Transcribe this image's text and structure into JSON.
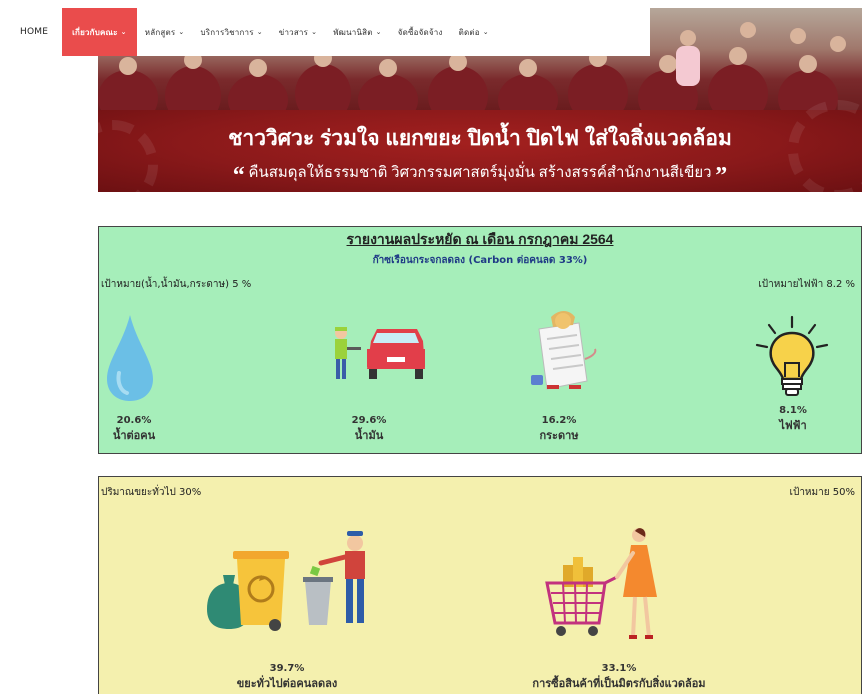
{
  "nav": {
    "items": [
      {
        "label": "HOME",
        "active": false,
        "has_chevron": false
      },
      {
        "label": "เกี่ยวกับคณะ",
        "active": true,
        "has_chevron": true
      },
      {
        "label": "หลักสูตร",
        "active": false,
        "has_chevron": true
      },
      {
        "label": "บริการวิชาการ",
        "active": false,
        "has_chevron": true
      },
      {
        "label": "ข่าวสาร",
        "active": false,
        "has_chevron": true
      },
      {
        "label": "พัฒนานิสิต",
        "active": false,
        "has_chevron": true
      },
      {
        "label": "จัดซื้อจัดจ้าง",
        "active": false,
        "has_chevron": false
      },
      {
        "label": "ติดต่อ",
        "active": false,
        "has_chevron": true
      }
    ],
    "active_color": "#ea4c4c"
  },
  "banner": {
    "title": "ชาววิศวะ ร่วมใจ แยกขยะ ปิดน้ำ ปิดไฟ ใส่ใจสิ่งแวดล้อม",
    "subtitle": "คืนสมดุลให้ธรรมชาติ วิศวกรรมศาสตร์มุ่งมั่น สร้างสรรค์สำนักงานสีเขียว",
    "open_quote": "“",
    "close_quote": "”",
    "band_color": "#8a191a"
  },
  "energy_report": {
    "title": "รายงานผลประหยัด ณ เดือน กรกฎาคม 2564",
    "subtitle": "ก๊าซเรือนกระจกลดลง (Carbon ต่อคนลด 33%)",
    "target_left": "เป้าหมาย(น้ำ,น้ำมัน,กระดาษ) 5 %",
    "target_right": "เป้าหมายไฟฟ้า 8.2 %",
    "background": "#a6eeba",
    "stats": [
      {
        "value": "20.6%",
        "label": "น้ำต่อคน",
        "icon": "water-drop-icon"
      },
      {
        "value": "29.6%",
        "label": "น้ำมัน",
        "icon": "car-fuel-icon"
      },
      {
        "value": "16.2%",
        "label": "กระดาษ",
        "icon": "paper-icon"
      },
      {
        "value": "8.1%",
        "label": "ไฟฟ้า",
        "icon": "lightbulb-icon"
      }
    ]
  },
  "waste_report": {
    "label_left": "ปริมาณขยะทั่วไป 30%",
    "label_right": "เป้าหมาย 50%",
    "background": "#f4f0ae",
    "stats": [
      {
        "value": "39.7%",
        "label": "ขยะทั่วไปต่อคนลดลง",
        "icon": "recycle-bin-icon"
      },
      {
        "value": "33.1%",
        "label": "การซื้อสินค้าที่เป็นมิตรกับสิ่งแวดล้อม",
        "icon": "shopping-cart-icon"
      }
    ]
  }
}
